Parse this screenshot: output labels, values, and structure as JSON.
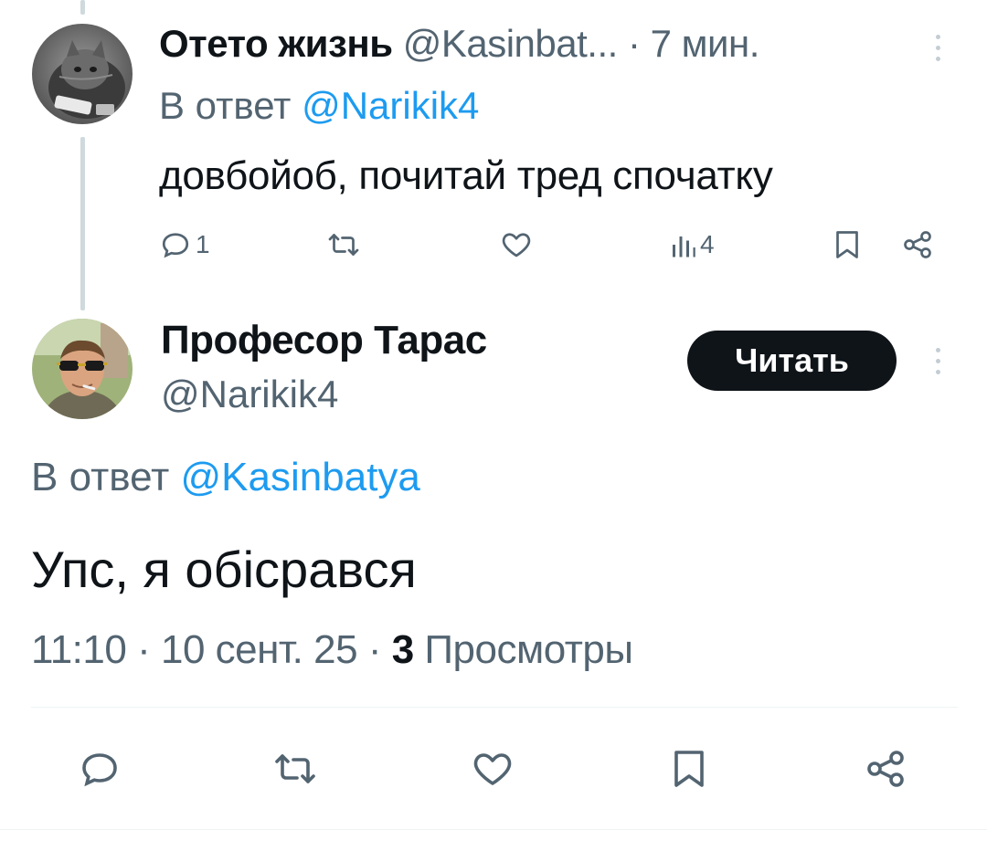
{
  "reply_tweet": {
    "author_name": "Отето жизнь",
    "author_handle": "@Kasinbat...",
    "dot": "·",
    "time": "7 мин.",
    "reply_prefix": "В ответ",
    "reply_to": "@Narikik4",
    "text": "довбойоб, почитай тред спочатку",
    "actions": {
      "reply_count": "1",
      "views_count": "4"
    }
  },
  "main_tweet": {
    "author_name": "Професор Тарас",
    "author_handle": "@Narikik4",
    "follow_label": "Читать",
    "reply_prefix": "В ответ",
    "reply_to": "@Kasinbatya",
    "text": "Упс, я обісрався",
    "time": "11:10",
    "date": "10 сент. 25",
    "dot": "·",
    "views_count": "3",
    "views_label": "Просмотры"
  },
  "colors": {
    "text_primary": "#0f1419",
    "text_secondary": "#536471",
    "link": "#1d9bf0",
    "thread_line": "#cfd9de",
    "button_bg": "#0f1419"
  }
}
